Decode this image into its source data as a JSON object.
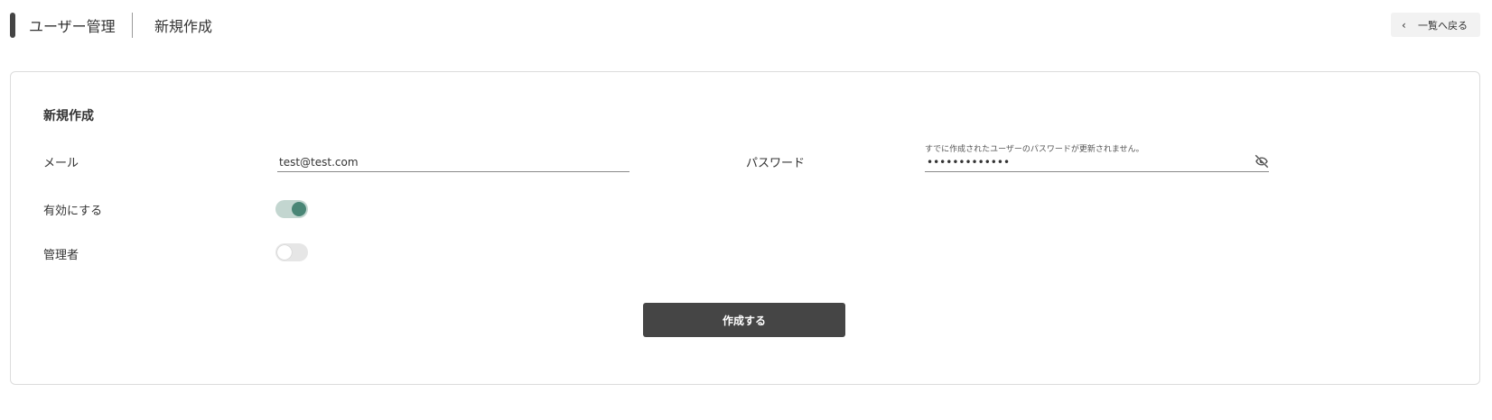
{
  "header": {
    "parent": "ユーザー管理",
    "current": "新規作成",
    "back_label": "一覧へ戻る",
    "back_icon": "chevron-left-icon"
  },
  "form": {
    "title": "新規作成",
    "email": {
      "label": "メール",
      "value": "test@test.com"
    },
    "password": {
      "label": "パスワード",
      "hint": "すでに作成されたユーザーのパスワードが更新されません。",
      "value": "•••••••••••••",
      "icon": "eye-off-icon"
    },
    "enabled": {
      "label": "有効にする",
      "checked": true
    },
    "admin": {
      "label": "管理者",
      "checked": false
    },
    "submit_label": "作成する"
  },
  "colors": {
    "toggle_on_track": "#c3d6d0",
    "toggle_on_knob": "#4a8676",
    "primary_button": "#454545"
  }
}
